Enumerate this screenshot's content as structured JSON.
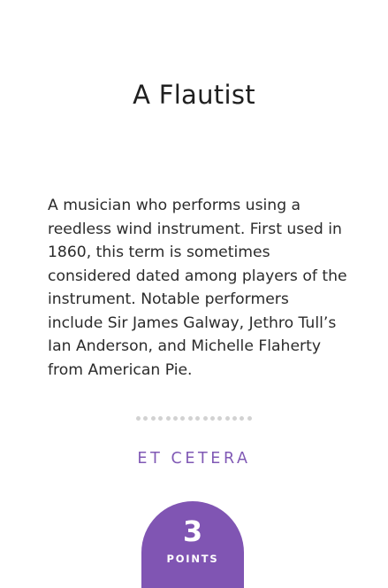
{
  "card": {
    "title": "A Flautist",
    "description": "A musician who performs using a reedless wind instrument. First used in 1860, this term is sometimes considered dated among players of the instrument. Notable performers include Sir James Galway, Jethro Tull’s Ian Anderson, and Michelle Flaherty from American Pie.",
    "category": "ET CETERA",
    "points": {
      "value": "3",
      "label": "POINTS"
    }
  },
  "colors": {
    "accent": "#8055b3",
    "title_text": "#1f1f1f",
    "body_text": "#2b2b2b",
    "divider_dots": "#d2d2d2"
  }
}
